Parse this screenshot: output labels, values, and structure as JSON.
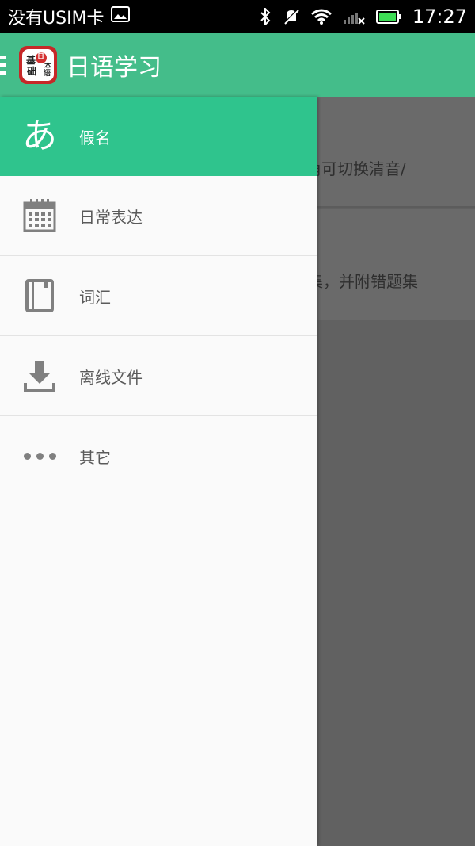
{
  "status_bar": {
    "carrier": "没有USIM卡",
    "time": "17:27",
    "icons": [
      "image-icon",
      "bluetooth-icon",
      "mute-icon",
      "wifi-icon",
      "signal-icon",
      "battery-icon"
    ]
  },
  "app_bar": {
    "title": "日语学习",
    "logo_glyphs": [
      "基",
      "日",
      "本",
      "础",
      "语"
    ]
  },
  "background": {
    "card1_text": "角可切换清音/",
    "card2_text": "集，并附错题集"
  },
  "drawer": {
    "items": [
      {
        "label": "假名",
        "icon": "kana-icon",
        "glyph": "あ"
      },
      {
        "label": "日常表达",
        "icon": "calendar-icon"
      },
      {
        "label": "词汇",
        "icon": "book-icon"
      },
      {
        "label": "离线文件",
        "icon": "download-icon"
      },
      {
        "label": "其它",
        "icon": "more-icon"
      }
    ]
  },
  "colors": {
    "primary": "#44bd8a",
    "active_item": "#2fc48d",
    "icon_gray": "#808080"
  }
}
